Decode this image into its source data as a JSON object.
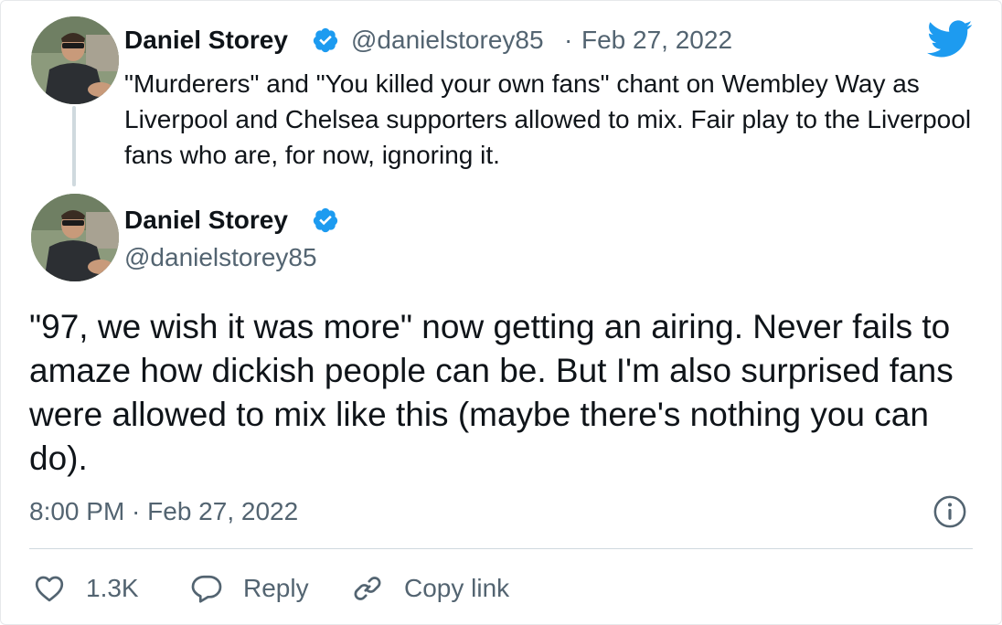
{
  "parent_tweet": {
    "display_name": "Daniel Storey",
    "handle": "@danielstorey85",
    "separator": "·",
    "date": "Feb 27, 2022",
    "text": "\"Murderers\" and \"You killed your own fans\" chant on Wembley Way as Liverpool and Chelsea supporters allowed to mix. Fair play to the Liverpool fans who are, for now, ignoring it."
  },
  "main_tweet": {
    "display_name": "Daniel Storey",
    "handle": "@danielstorey85",
    "text": "\"97, we wish it was more\" now getting an airing. Never fails to amaze how dickish people can be. But I'm also surprised fans were allowed to mix like this (maybe there's nothing you can do).",
    "timestamp": "8:00 PM · Feb 27, 2022"
  },
  "actions": {
    "like_count": "1.3K",
    "reply_label": "Reply",
    "copy_link_label": "Copy link"
  },
  "icons": {
    "verified": "verified-badge-icon",
    "brand": "twitter-bird-icon",
    "info": "info-icon",
    "like": "heart-icon",
    "reply": "speech-bubble-icon",
    "copy": "link-icon"
  },
  "colors": {
    "brand_blue": "#1d9bf0",
    "text_primary": "#0f1419",
    "text_secondary": "#536471",
    "divider": "#cfd9de"
  }
}
